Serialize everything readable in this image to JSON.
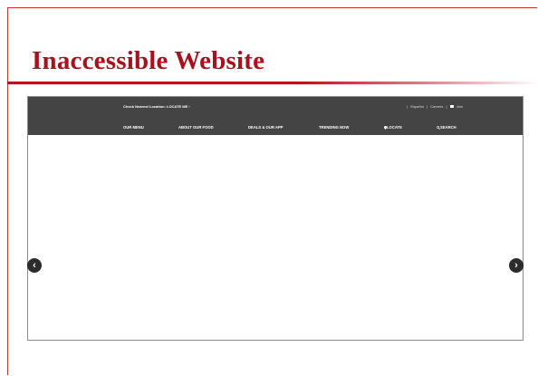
{
  "slide": {
    "title": "Inaccessible Website"
  },
  "site": {
    "topbar": {
      "location_text": "Check Nearest Location:",
      "locate_me": "LOCATE ME",
      "locate_me_chevron": "›",
      "espanol": "Español",
      "careers": "Careers",
      "join": "Join",
      "separator": "|"
    },
    "nav": {
      "our_menu": "OUR MENU",
      "about_food": "ABOUT OUR FOOD",
      "deals_app": "DEALS & OUR APP",
      "trending": "TRENDING NOW",
      "locate": "LOCATE",
      "search": "SEARCH"
    },
    "carousel": {
      "prev_glyph": "‹",
      "next_glyph": "›"
    }
  },
  "colors": {
    "title": "#a8121e",
    "rule": "#b3141f",
    "header_bg": "#444444",
    "arrow_bg": "#2c2c2c"
  }
}
